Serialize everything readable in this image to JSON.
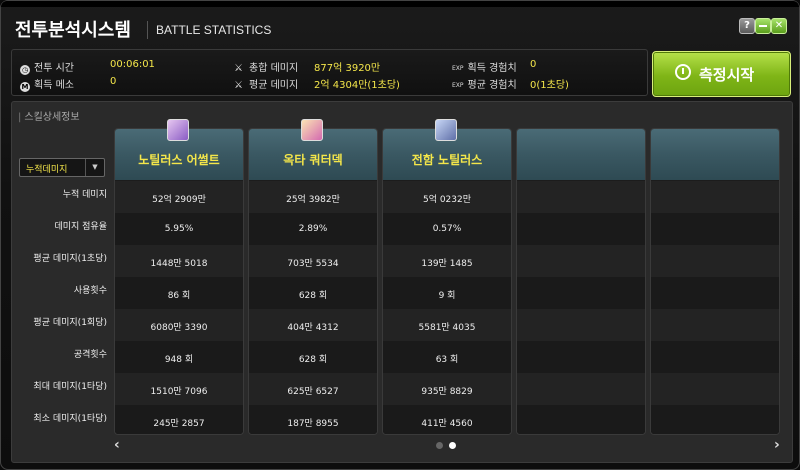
{
  "window": {
    "title": "전투분석시스템",
    "subtitle": "BATTLE STATISTICS",
    "help_label": "?"
  },
  "stats": {
    "battle_time_label": "전투 시간",
    "battle_time_value": "00:06:01",
    "meso_label": "획득 메소",
    "meso_value": "0",
    "total_damage_label": "총합 데미지",
    "total_damage_value": "877억 3920만",
    "avg_damage_label": "평균 데미지",
    "avg_damage_value": "2억 4304만(1초당)",
    "exp_label": "획득 경험치",
    "exp_value": "0",
    "avg_exp_label": "평균 경험치",
    "avg_exp_value": "0(1초당)",
    "exp_badge": "EXP",
    "icon_clock": "clock-icon",
    "icon_meso": "meso-icon",
    "icon_sword": "sword-icon"
  },
  "measure_button": {
    "label": "측정시작",
    "icon": "gauge-icon"
  },
  "panel": {
    "section_title": "스킬상세정보",
    "dropdown_value": "누적데미지",
    "row_labels": [
      "누적 데미지",
      "데미지 점유율",
      "평균 데미지(1초당)",
      "사용횟수",
      "평균 데미지(1회당)",
      "공격횟수",
      "최대 데미지(1타당)",
      "최소 데미지(1타당)"
    ],
    "columns": [
      {
        "name": "노틸러스 어썰트",
        "icon": "nautilus-assault-icon",
        "values": [
          "52억 2909만",
          "5.95%",
          "1448만 5018",
          "86 회",
          "6080만 3390",
          "948 회",
          "1510만 7096",
          "245만 2857"
        ]
      },
      {
        "name": "옥타 쿼터덱",
        "icon": "octa-quarterdeck-icon",
        "values": [
          "25억 3982만",
          "2.89%",
          "703만 5534",
          "628 회",
          "404만 4312",
          "628 회",
          "625만 6527",
          "187만 8955"
        ]
      },
      {
        "name": "전함 노틸러스",
        "icon": "battleship-nautilus-icon",
        "values": [
          "5억 0232만",
          "0.57%",
          "139만 1485",
          "9 회",
          "5581만 4035",
          "63 회",
          "935만 8829",
          "411만 4560"
        ]
      },
      {
        "name": "",
        "icon": "",
        "values": [
          "",
          "",
          "",
          "",
          "",
          "",
          "",
          ""
        ]
      },
      {
        "name": "",
        "icon": "",
        "values": [
          "",
          "",
          "",
          "",
          "",
          "",
          "",
          ""
        ]
      }
    ],
    "nav_prev": "‹",
    "nav_next": "›",
    "page_count": 2,
    "current_page": 2
  },
  "colors": {
    "accent_yellow": "#f4e64a",
    "header_teal": "#3a5862",
    "button_green": "#7fb517"
  }
}
